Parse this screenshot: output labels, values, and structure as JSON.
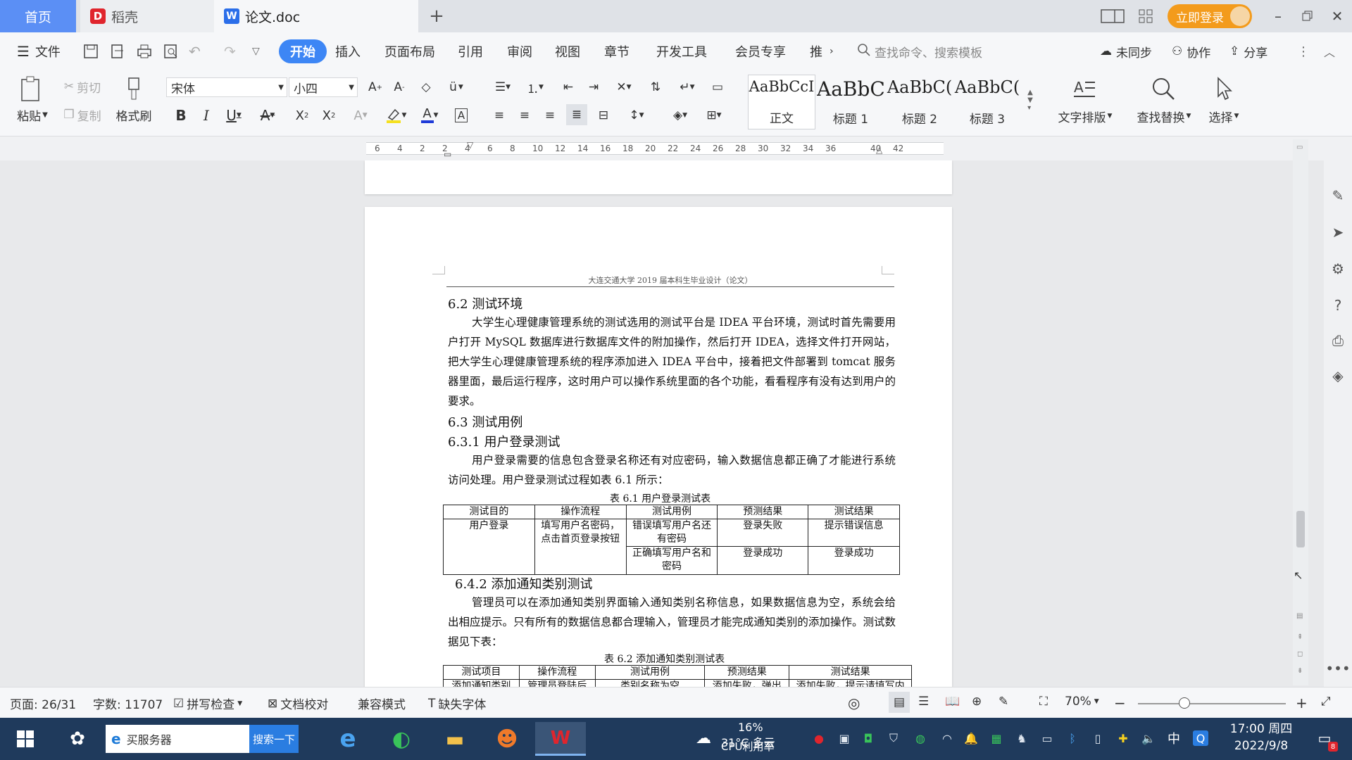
{
  "tabs": {
    "home": "首页",
    "daoke": "稻壳",
    "doc": "论文.doc",
    "add": "+",
    "login": "立即登录"
  },
  "menu": {
    "file": "文件",
    "items": [
      "开始",
      "插入",
      "页面布局",
      "引用",
      "审阅",
      "视图",
      "章节",
      "开发工具",
      "会员专享",
      "推"
    ],
    "search_placeholder": "查找命令、搜索模板",
    "sync": "未同步",
    "collab": "协作",
    "share": "分享"
  },
  "ribbon": {
    "paste": "粘贴",
    "cut": "剪切",
    "copy": "复制",
    "format_painter": "格式刷",
    "font_name": "宋体",
    "font_size": "小四",
    "styles": [
      {
        "sample": "AaBbCcI",
        "name": "正文"
      },
      {
        "sample": "AaBbC",
        "name": "标题 1"
      },
      {
        "sample": "AaBbC(",
        "name": "标题 2"
      },
      {
        "sample": "AaBbC(",
        "name": "标题 3"
      }
    ],
    "text_layout": "文字排版",
    "find_replace": "查找替换",
    "select": "选择"
  },
  "ruler": {
    "ticks": [
      "6",
      "4",
      "2",
      "2",
      "4",
      "6",
      "8",
      "10",
      "12",
      "14",
      "16",
      "18",
      "20",
      "22",
      "24",
      "26",
      "28",
      "30",
      "32",
      "34",
      "36",
      "40",
      "42"
    ]
  },
  "document": {
    "header": "大连交通大学 2019 届本科生毕业设计（论文）",
    "s62_title": "6.2 测试环境",
    "s62_para": "大学生心理健康管理系统的测试选用的测试平台是 IDEA 平台环境，测试时首先需要用户打开 MySQL 数据库进行数据库文件的附加操作，然后打开 IDEA，选择文件打开网站，把大学生心理健康管理系统的程序添加进入 IDEA 平台中，接着把文件部署到 tomcat 服务器里面，最后运行程序，这时用户可以操作系统里面的各个功能，看看程序有没有达到用户的要求。",
    "s63_title": "6.3  测试用例",
    "s631_title": "6.3.1  用户登录测试",
    "s631_para": "用户登录需要的信息包含登录名称还有对应密码，输入数据信息都正确了才能进行系统访问处理。用户登录测试过程如表 6.1 所示：",
    "table1_caption": "表 6.1    用户登录测试表",
    "table1": {
      "headers": [
        "测试目的",
        "操作流程",
        "测试用例",
        "预测结果",
        "测试结果"
      ],
      "purpose": "用户登录",
      "flow": "填写用户名密码，点击首页登录按钮",
      "case1": "错误填写用户名还有密码",
      "expect1": "登录失败",
      "result1": "提示错误信息",
      "case2": "正确填写用户名和密码",
      "expect2": "登录成功",
      "result2": "登录成功"
    },
    "s642_title": "6.4.2  添加通知类别测试",
    "s642_para": "管理员可以在添加通知类别界面输入通知类别名称信息，如果数据信息为空，系统会给出相应提示。只有所有的数据信息都合理输入，管理员才能完成通知类别的添加操作。测试数据见下表：",
    "table2_caption": "表 6.2 添加通知类别测试表",
    "table2": {
      "headers": [
        "测试项目",
        "操作流程",
        "测试用例",
        "预测结果",
        "测试结果"
      ],
      "row1": [
        "添加通知类别",
        "管理员登陆后",
        "类别名称为空",
        "添加失败，弹出",
        "添加失败，提示请填写内"
      ]
    }
  },
  "statusbar": {
    "page": "页面: 26/31",
    "words": "字数: 11707",
    "spell": "拼写检查",
    "proof": "文档校对",
    "compat": "兼容模式",
    "missing_font": "缺失字体",
    "zoom": "70%"
  },
  "taskbar": {
    "search_text": "买服务器",
    "search_btn": "搜索一下",
    "weather": "31°C 多云",
    "cpu_percent": "16%",
    "cpu_label": "CPU利用率",
    "ime": "中",
    "time": "17:00 周四",
    "date": "2022/9/8",
    "notif_count": "8"
  },
  "colors": {
    "accent": "#3d86f5",
    "login": "#f39b1c",
    "taskbar": "#1f3a5c"
  }
}
